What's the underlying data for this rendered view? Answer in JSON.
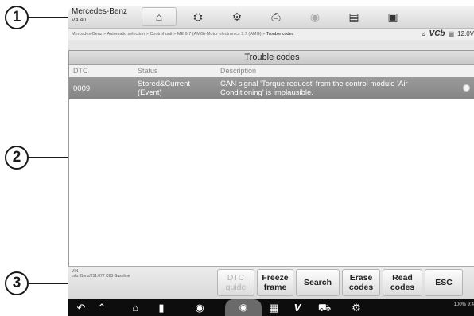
{
  "callouts": [
    "1",
    "2",
    "3"
  ],
  "topbar": {
    "brand": "Mercedes-Benz",
    "version": "V4.40",
    "icons": [
      "home-icon",
      "vehicle-swap-icon",
      "gear-icon",
      "printer-icon",
      "record-icon",
      "save-icon",
      "message-icon"
    ]
  },
  "breadcrumb": {
    "path": "Mercedes-Benz > Automatic selection > Control unit > ME 9.7 (AMG)-Motor electronics 9.7 (AMG) > ",
    "current": "Trouble codes"
  },
  "vci": {
    "label": "VCb",
    "voltage": "12.0V"
  },
  "panel": {
    "title": "Trouble codes",
    "columns": [
      "DTC",
      "Status",
      "Description"
    ],
    "rows": [
      {
        "dtc": "0009",
        "status_line1": "Stored&Current",
        "status_line2": "(Event)",
        "desc_line1": "CAN signal 'Torque request' from the control module 'Air",
        "desc_line2": "Conditioning' is implausible."
      }
    ]
  },
  "footer": {
    "vin_label": "VIN",
    "info": "Info: Benz/211.077 C63 Gasoline",
    "buttons": {
      "dtc_guide_1": "DTC",
      "dtc_guide_2": "guide",
      "freeze_1": "Freeze",
      "freeze_2": "frame",
      "search": "Search",
      "erase_1": "Erase",
      "erase_2": "codes",
      "read_1": "Read",
      "read_2": "codes",
      "esc": "ESC"
    }
  },
  "statusbar": {
    "text": "100% 9:4"
  },
  "colors": {
    "selected_row": "#8c8c8c",
    "nav_bg": "#0d0d0d"
  }
}
